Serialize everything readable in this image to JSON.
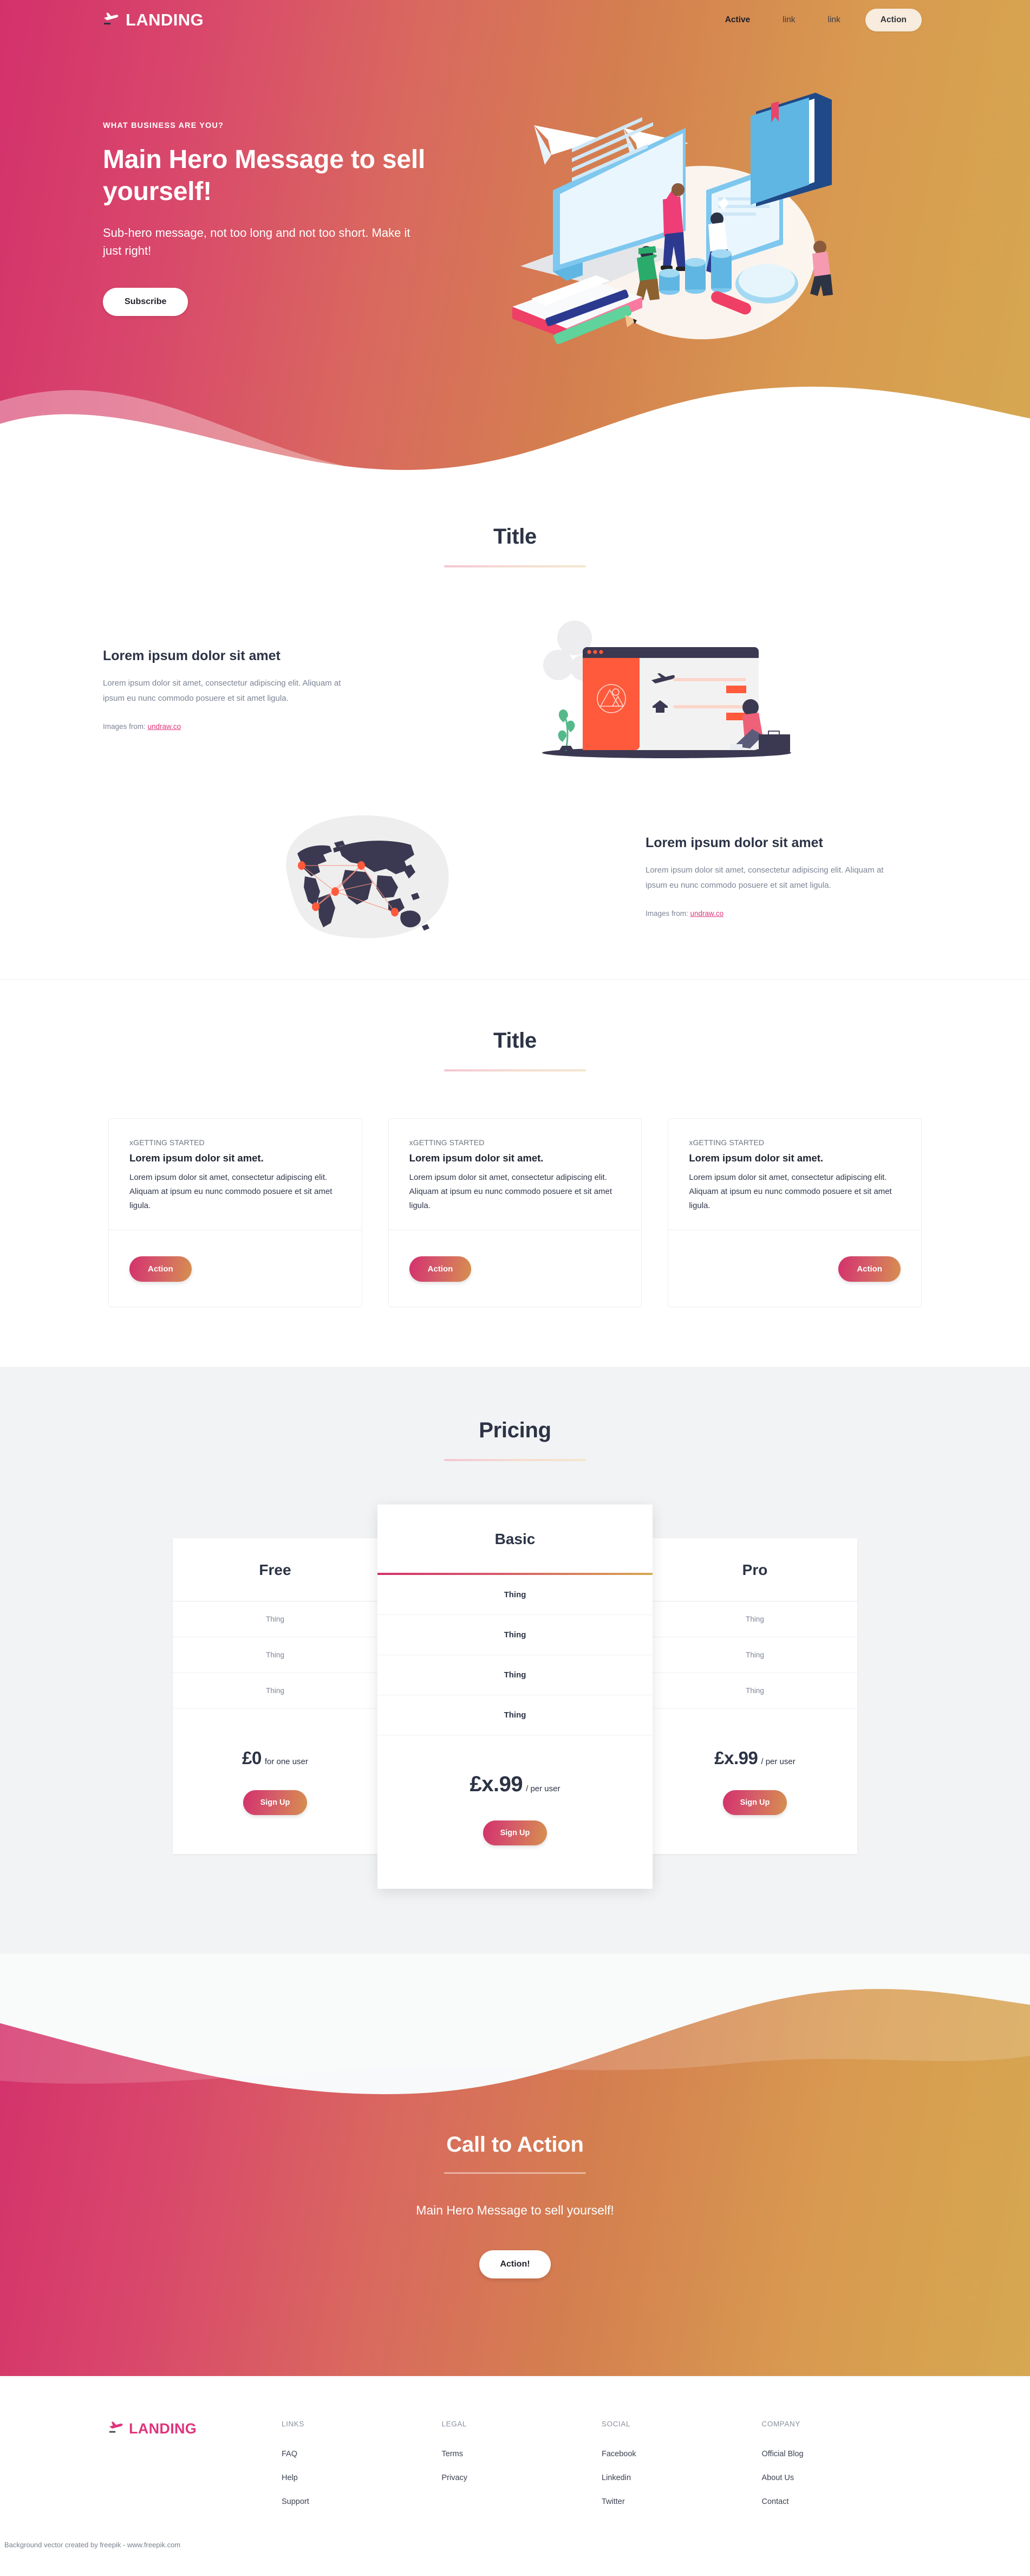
{
  "brand": {
    "name": "LANDING",
    "icon": "plane-landing-icon"
  },
  "nav": {
    "links": [
      {
        "label": "Active",
        "state": "active"
      },
      {
        "label": "link",
        "state": "default"
      },
      {
        "label": "link",
        "state": "default"
      }
    ],
    "action_label": "Action"
  },
  "hero": {
    "eyebrow": "WHAT BUSINESS ARE YOU?",
    "title": "Main Hero Message to sell yourself!",
    "subtitle": "Sub-hero message, not too long and not too short. Make it just right!",
    "button_label": "Subscribe",
    "illustration": "isometric-team-working-illustration"
  },
  "features": {
    "title": "Title",
    "rows": [
      {
        "heading": "Lorem ipsum dolor sit amet",
        "body": "Lorem ipsum dolor sit amet, consectetur adipiscing elit. Aliquam at ipsum eu nunc commodo posuere et sit amet ligula.",
        "credit_prefix": "Images from: ",
        "credit_link": "undraw.co",
        "illustration": "browser-window-booking-illustration"
      },
      {
        "heading": "Lorem ipsum dolor sit amet",
        "body": "Lorem ipsum dolor sit amet, consectetur adipiscing elit. Aliquam at ipsum eu nunc commodo posuere et sit amet ligula.",
        "credit_prefix": "Images from: ",
        "credit_link": "undraw.co",
        "illustration": "world-map-connections-illustration"
      }
    ]
  },
  "cards_section": {
    "title": "Title",
    "cards": [
      {
        "eyebrow": "xGETTING STARTED",
        "heading": "Lorem ipsum dolor sit amet.",
        "body": "Lorem ipsum dolor sit amet, consectetur adipiscing elit. Aliquam at ipsum eu nunc commodo posuere et sit amet ligula.",
        "button_label": "Action"
      },
      {
        "eyebrow": "xGETTING STARTED",
        "heading": "Lorem ipsum dolor sit amet.",
        "body": "Lorem ipsum dolor sit amet, consectetur adipiscing elit. Aliquam at ipsum eu nunc commodo posuere et sit amet ligula.",
        "button_label": "Action"
      },
      {
        "eyebrow": "xGETTING STARTED",
        "heading": "Lorem ipsum dolor sit amet.",
        "body": "Lorem ipsum dolor sit amet, consectetur adipiscing elit. Aliquam at ipsum eu nunc commodo posuere et sit amet ligula.",
        "button_label": "Action"
      }
    ]
  },
  "pricing": {
    "title": "Pricing",
    "plans": [
      {
        "name": "Free",
        "featured": false,
        "features": [
          "Thing",
          "Thing",
          "Thing"
        ],
        "amount": "£0",
        "unit": "for one user",
        "button_label": "Sign Up"
      },
      {
        "name": "Basic",
        "featured": true,
        "features": [
          "Thing",
          "Thing",
          "Thing",
          "Thing"
        ],
        "amount": "£x.99",
        "unit": "/ per user",
        "button_label": "Sign Up"
      },
      {
        "name": "Pro",
        "featured": false,
        "features": [
          "Thing",
          "Thing",
          "Thing"
        ],
        "amount": "£x.99",
        "unit": "/ per user",
        "button_label": "Sign Up"
      }
    ]
  },
  "cta": {
    "title": "Call to Action",
    "subtitle": "Main Hero Message to sell yourself!",
    "button_label": "Action!"
  },
  "footer": {
    "brand": "LANDING",
    "columns": [
      {
        "heading": "LINKS",
        "links": [
          "FAQ",
          "Help",
          "Support"
        ]
      },
      {
        "heading": "LEGAL",
        "links": [
          "Terms",
          "Privacy"
        ]
      },
      {
        "heading": "SOCIAL",
        "links": [
          "Facebook",
          "Linkedin",
          "Twitter"
        ]
      },
      {
        "heading": "COMPANY",
        "links": [
          "Official Blog",
          "About Us",
          "Contact"
        ]
      }
    ],
    "note": "Background vector created by freepik - www.freepik.com"
  },
  "colors": {
    "brand_pink": "#d3316b",
    "brand_gold": "#d6a851",
    "link_pink": "#e0357c",
    "heading_navy": "#2c3345",
    "body_grey": "#7d8495",
    "pricing_bg": "#f2f3f5"
  }
}
